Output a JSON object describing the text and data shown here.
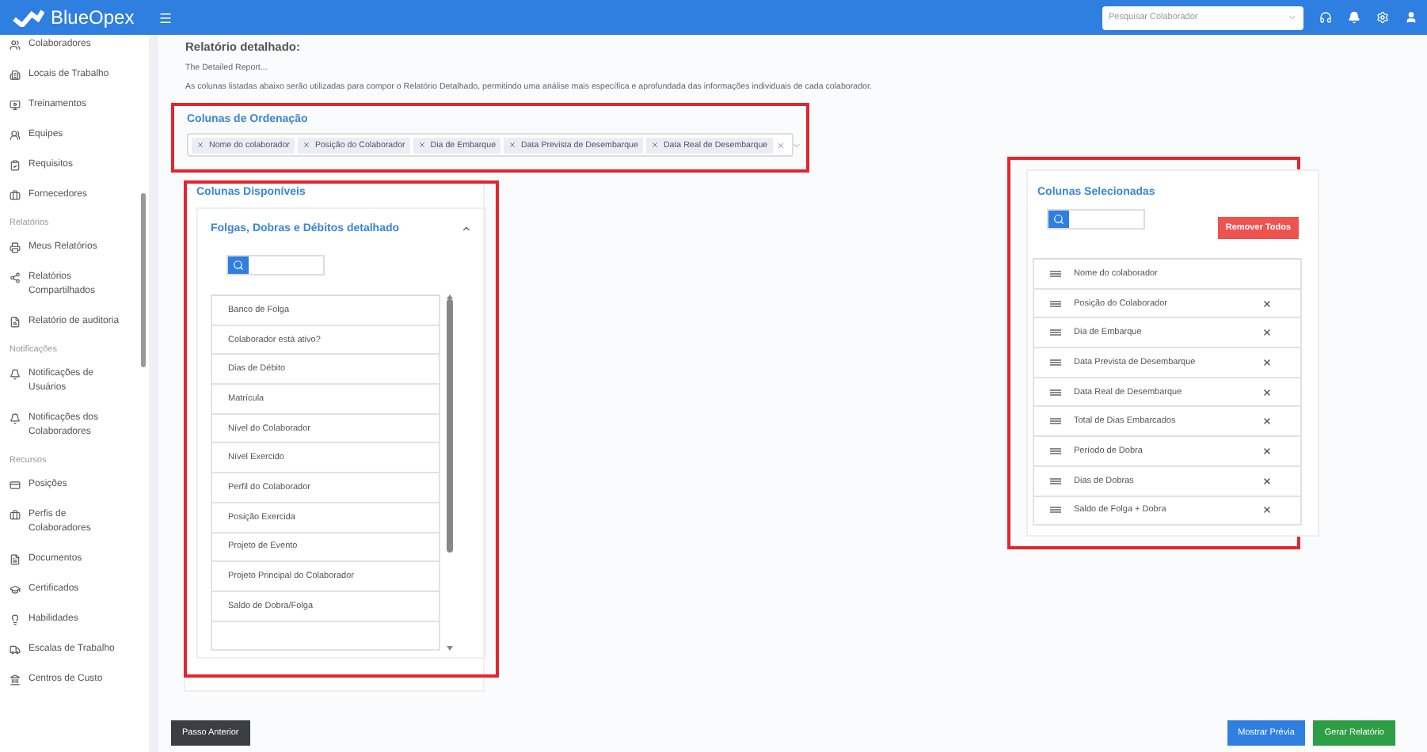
{
  "header": {
    "brand": "BlueOpex",
    "search": {
      "placeholder": "Pesquisar Colaborador"
    }
  },
  "sidebar": {
    "sections": [
      {
        "items": [
          {
            "label": "Colaboradores"
          },
          {
            "label": "Locais de Trabalho"
          },
          {
            "label": "Treinamentos"
          },
          {
            "label": "Equipes"
          },
          {
            "label": "Requisitos"
          },
          {
            "label": "Fornecedores"
          }
        ]
      },
      {
        "heading": "Relatórios",
        "items": [
          {
            "label": "Meus Relatórios"
          },
          {
            "label": "Relatórios Compartilhados"
          },
          {
            "label": "Relatório de auditoria"
          }
        ]
      },
      {
        "heading": "Notificações",
        "items": [
          {
            "label": "Notificações de Usuários"
          },
          {
            "label": "Notificações dos Colaboradores"
          }
        ]
      },
      {
        "heading": "Recursos",
        "items": [
          {
            "label": "Posições"
          },
          {
            "label": "Perfis de Colaboradores"
          },
          {
            "label": "Documentos"
          },
          {
            "label": "Certificados"
          },
          {
            "label": "Habilidades"
          },
          {
            "label": "Escalas de Trabalho"
          },
          {
            "label": "Centros de Custo"
          }
        ]
      }
    ]
  },
  "report": {
    "title": "Relatório detalhado:",
    "subtitle": "The Detailed Report...",
    "description": "As colunas listadas abaixo serão utilizadas para compor o Relatório Detalhado, permitindo uma análise mais específica e aprofundada das informações individuais de cada colaborador."
  },
  "ordering": {
    "title": "Colunas de Ordenação",
    "tags": [
      "Nome do colaborador",
      "Posição do Colaborador",
      "Dia de Embarque",
      "Data Prevista de Desembarque",
      "Data Real de Desembarque"
    ]
  },
  "available": {
    "title": "Colunas Disponíveis",
    "group": {
      "title": "Folgas, Dobras e Débitos detalhado",
      "expanded": true,
      "items": [
        "Banco de Folga",
        "Colaborador está ativo?",
        "Dias de Débito",
        "Matrícula",
        "Nível do Colaborador",
        "Nível Exercido",
        "Perfil do Colaborador",
        "Posição Exercida",
        "Projeto de Evento",
        "Projeto Principal do Colaborador",
        "Saldo de Dobra/Folga"
      ]
    }
  },
  "selected": {
    "title": "Colunas Selecionadas",
    "remove_all": "Remover Todos",
    "items": [
      {
        "label": "Nome do colaborador",
        "removable": false
      },
      {
        "label": "Posição do Colaborador",
        "removable": true
      },
      {
        "label": "Dia de Embarque",
        "removable": true
      },
      {
        "label": "Data Prevista de Desembarque",
        "removable": true
      },
      {
        "label": "Data Real de Desembarque",
        "removable": true
      },
      {
        "label": "Total de Dias Embarcados",
        "removable": true
      },
      {
        "label": "Período de Dobra",
        "removable": true
      },
      {
        "label": "Dias de Dobras",
        "removable": true
      },
      {
        "label": "Saldo de Folga + Dobra",
        "removable": true
      }
    ]
  },
  "footer": {
    "back": "Passo Anterior",
    "preview": "Mostrar Prévia",
    "generate": "Gerar Relatório"
  }
}
